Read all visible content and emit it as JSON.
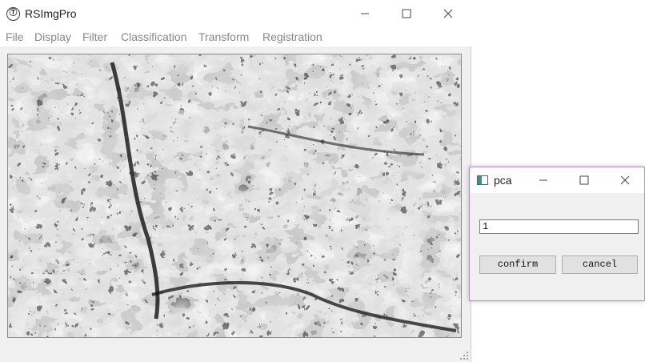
{
  "main_window": {
    "title": "RSImgPro",
    "icon": "app-logo-icon",
    "controls": [
      "minimize-icon",
      "maximize-icon",
      "close-icon"
    ]
  },
  "menu": {
    "items": [
      {
        "label": "File"
      },
      {
        "label": "Display"
      },
      {
        "label": "Filter"
      },
      {
        "label": "Classification"
      },
      {
        "label": "Transform"
      },
      {
        "label": "Registration"
      }
    ]
  },
  "image_view": {
    "description_icon": "raster-image"
  },
  "dialog": {
    "title": "pca",
    "input_value": "1",
    "confirm_label": "confirm",
    "cancel_label": "cancel"
  },
  "colors": {
    "menu_text": "#888888",
    "dialog_border": "#b98fc9",
    "button_bg": "#e1e1e1"
  }
}
